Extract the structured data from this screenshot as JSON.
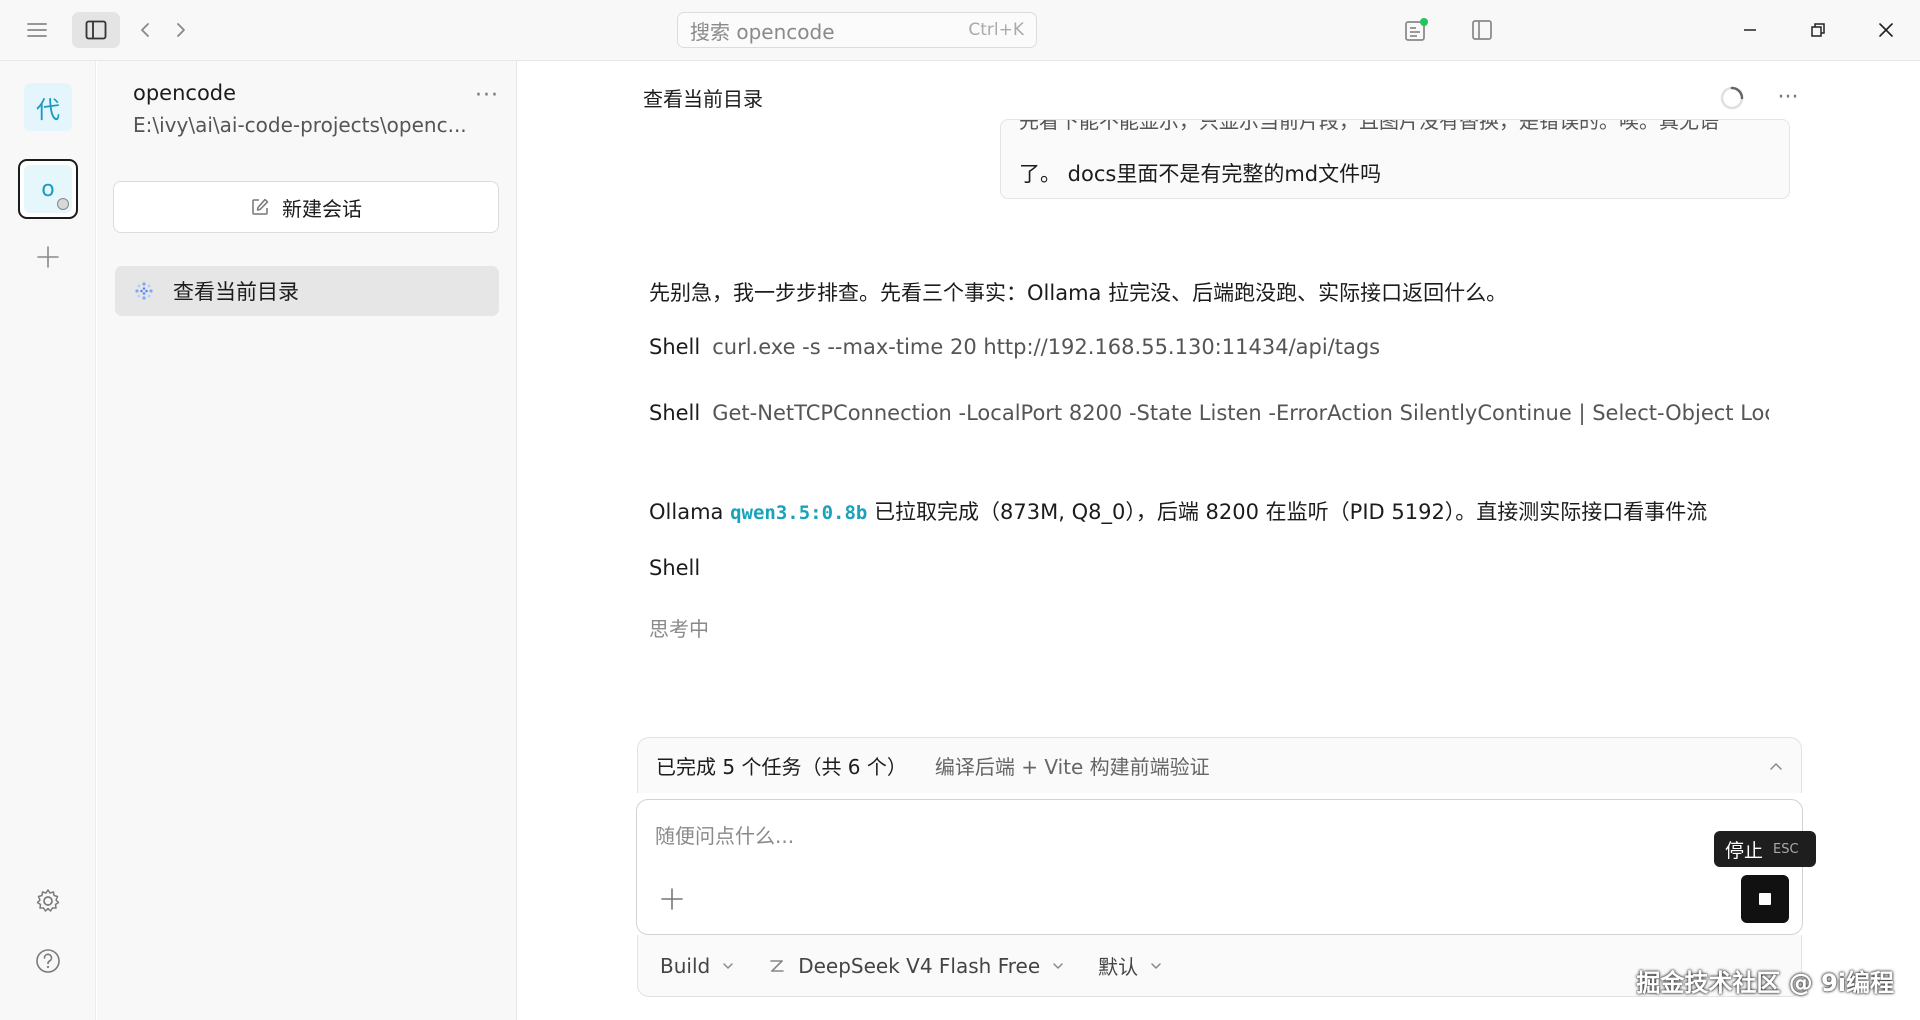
{
  "titlebar": {
    "search_placeholder": "搜索 opencode",
    "search_shortcut": "Ctrl+K"
  },
  "rail": {
    "project_a_glyph": "代",
    "project_b_glyph": "o"
  },
  "sidebar": {
    "project_name": "opencode",
    "project_path": "E:\\ivy\\ai\\ai-code-projects\\openc...",
    "more": "···",
    "new_session_label": "新建会话",
    "sessions": [
      {
        "label": "查看当前目录"
      }
    ]
  },
  "main": {
    "title": "查看当前目录",
    "more": "···",
    "user_message": {
      "line1": "先看下能不能显示，只显示当前片段，且图片没有替换，是错误的。唉。真无语",
      "line2": "了。 docs里面不是有完整的md文件吗"
    },
    "assistant": {
      "intro": "先别急，我一步步排查。先看三个事实：Ollama 拉完没、后端跑没跑、实际接口返回什么。",
      "shell_label": "Shell",
      "shell1_cmd": "curl.exe -s --max-time 20 http://192.168.55.130:11434/api/tags",
      "shell2_cmd": "Get-NetTCPConnection -LocalPort 8200 -State Listen -ErrorAction SilentlyContinue | Select-Object LocalA",
      "status_prefix": "Ollama",
      "status_model": "qwen3.5:0.8b",
      "status_suffix": "已拉取完成（873M, Q8_0），后端 8200 在监听（PID 5192）。直接测实际接口看事件流",
      "shell3_label": "Shell",
      "thinking": "思考中"
    }
  },
  "composer": {
    "tasks_done": "已完成 5 个任务（共 6 个）",
    "tasks_current": "编译后端 + Vite 构建前端验证",
    "placeholder": "随便问点什么...",
    "stop_tooltip": "停止",
    "stop_tooltip_key": "ESC",
    "agent": "Build",
    "model": "DeepSeek V4 Flash Free",
    "variant": "默认"
  },
  "watermark": "掘金技术社区 @ 9i编程",
  "colors": {
    "accent_code": "#1aa3b8",
    "status_dot": "#22c55e"
  }
}
